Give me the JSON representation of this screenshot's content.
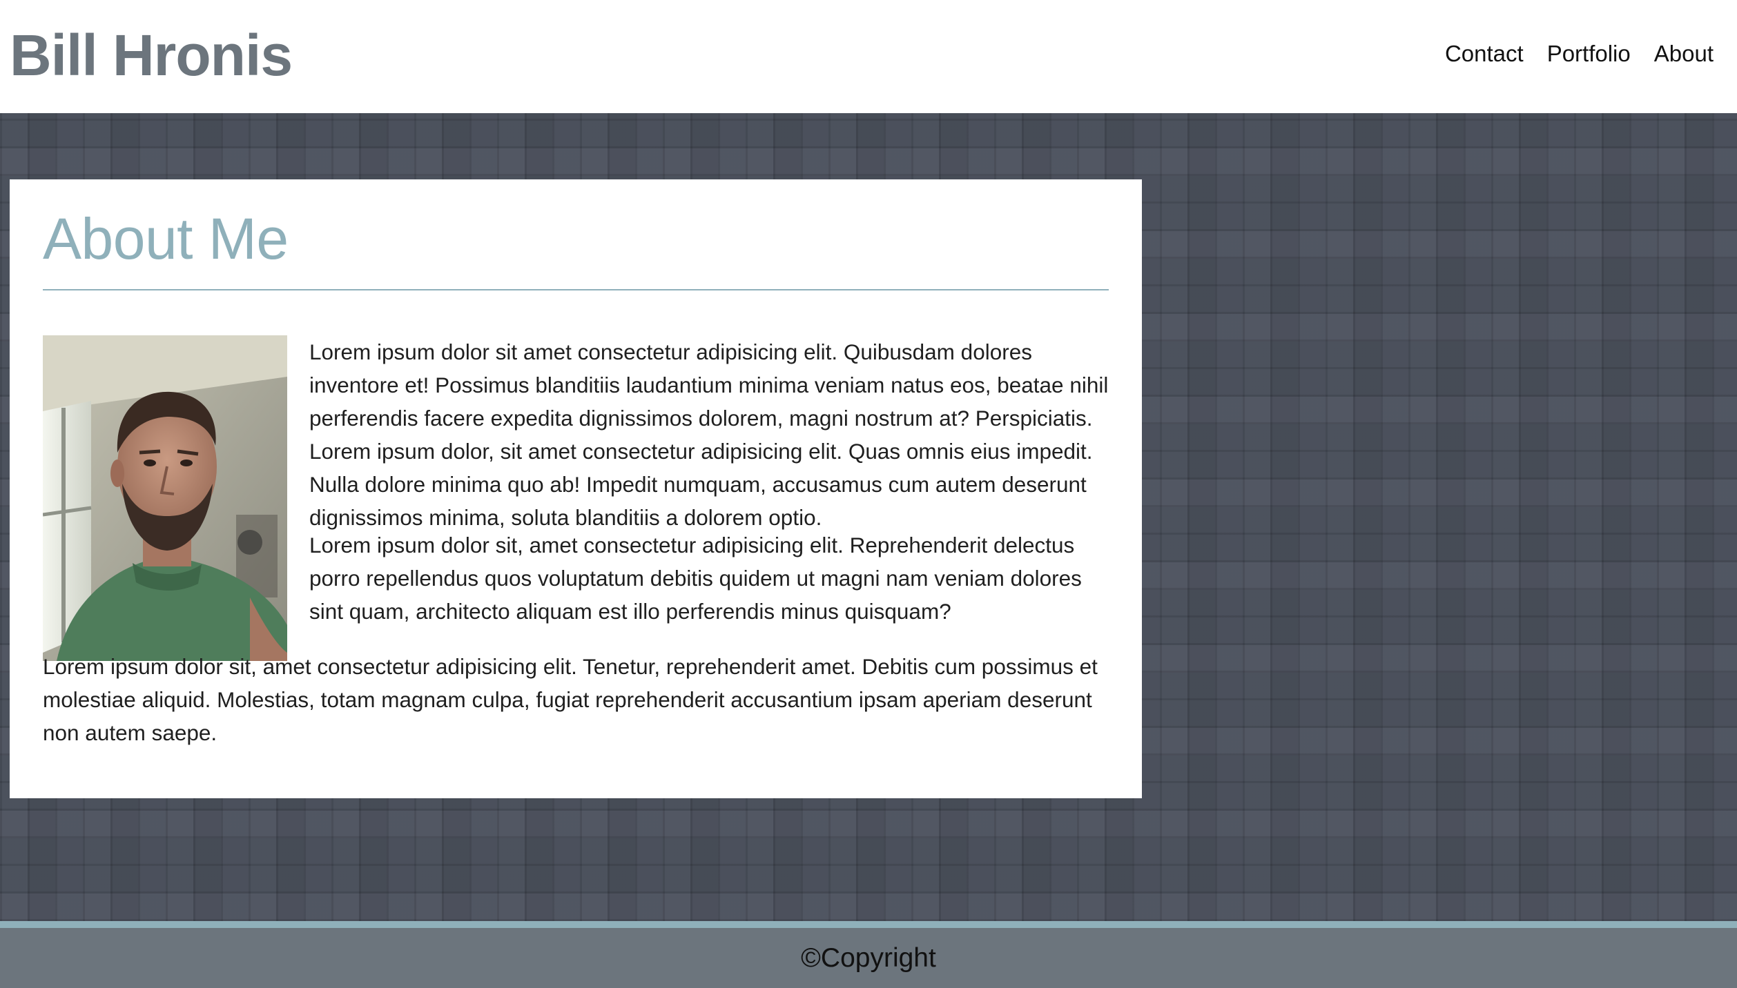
{
  "header": {
    "site_title": "Bill Hronis",
    "nav": [
      {
        "label": "Contact"
      },
      {
        "label": "Portfolio"
      },
      {
        "label": "About"
      }
    ]
  },
  "about": {
    "heading": "About Me",
    "portrait_alt": "Portrait photo of Bill Hronis",
    "paragraphs": [
      "Lorem ipsum dolor sit amet consectetur adipisicing elit. Quibusdam dolores inventore et! Possimus blanditiis laudantium minima veniam natus eos, beatae nihil perferendis facere expedita dignissimos dolorem, magni nostrum at? Perspiciatis. Lorem ipsum dolor, sit amet consectetur adipisicing elit. Quas omnis eius impedit. Nulla dolore minima quo ab! Impedit numquam, accusamus cum autem deserunt dignissimos minima, soluta blanditiis a dolorem optio.",
      "Lorem ipsum dolor sit, amet consectetur adipisicing elit. Reprehenderit delectus porro repellendus quos voluptatum debitis quidem ut magni nam veniam dolores sint quam, architecto aliquam est illo perferendis minus quisquam?",
      "Lorem ipsum dolor sit, amet consectetur adipisicing elit. Tenetur, reprehenderit amet. Debitis cum possimus et molestiae aliquid. Molestias, totam magnam culpa, fugiat reprehenderit accusantium ipsam aperiam deserunt non autem saepe."
    ]
  },
  "footer": {
    "copyright": "©Copyright"
  },
  "colors": {
    "title_gray": "#6c757d",
    "accent": "#8fb0ba",
    "background_tile": "#4a505c",
    "footer_bg": "#6c757d"
  }
}
